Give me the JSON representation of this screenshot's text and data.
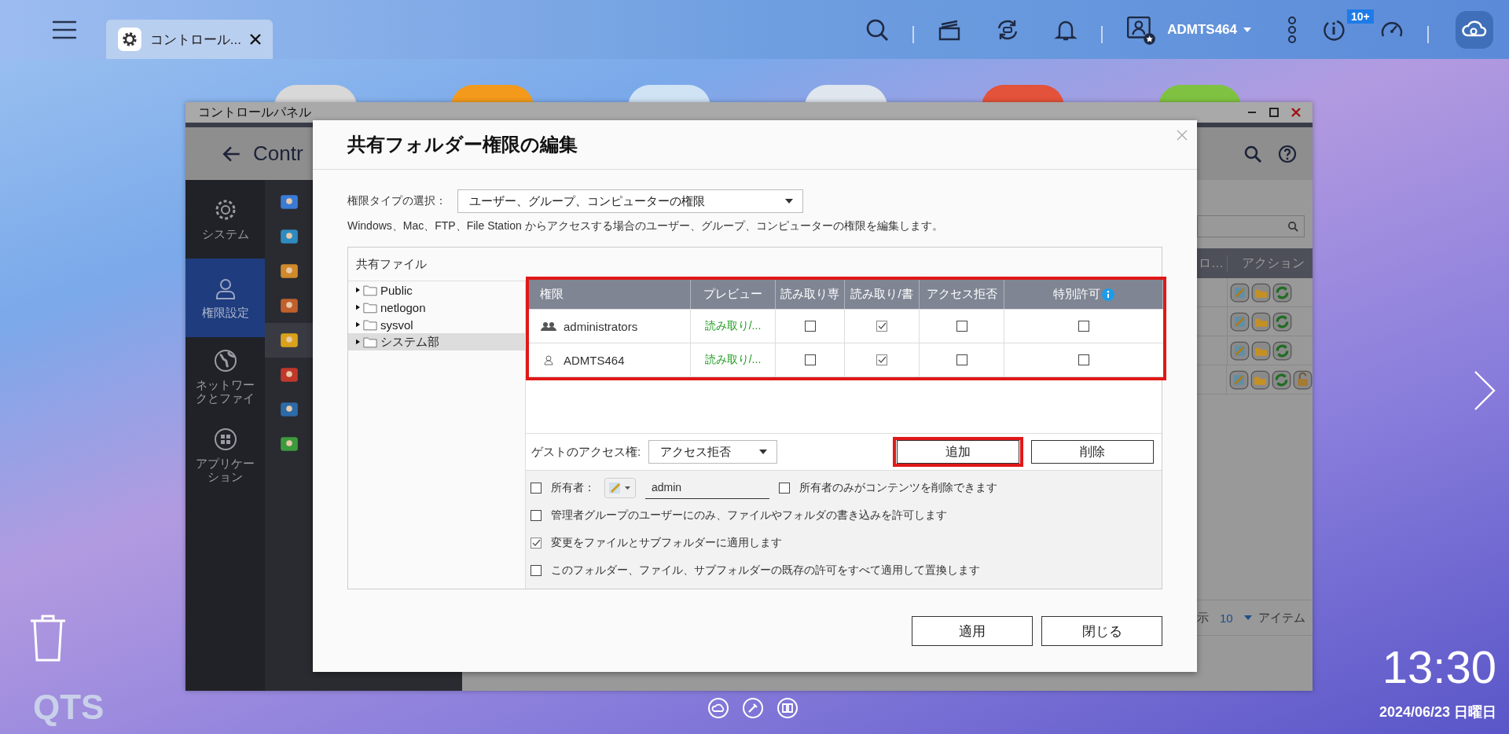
{
  "taskbar": {
    "tab": {
      "title": "コントロール..."
    },
    "user": "ADMTS464",
    "notification_badge": "10+"
  },
  "desktop": {
    "logo": "QTS",
    "clock": "13:30",
    "date": "2024/06/23 日曜日"
  },
  "control_panel": {
    "title": "コントロールパネル",
    "header": "Contr",
    "nav": [
      {
        "label": "システム",
        "selected": false
      },
      {
        "label": "権限設定",
        "selected": true
      },
      {
        "label": "ネットワークとファイ",
        "selected": false
      },
      {
        "label": "アプリケーション",
        "selected": false
      }
    ],
    "sub_items": [
      {
        "selected": false
      },
      {
        "selected": false
      },
      {
        "selected": false
      },
      {
        "selected": false
      },
      {
        "selected": true
      },
      {
        "selected": false
      },
      {
        "selected": false
      },
      {
        "selected": false
      }
    ],
    "table": {
      "columns": [
        "ロ…",
        "アクション"
      ],
      "rows": [
        {
          "locked": false
        },
        {
          "locked": false
        },
        {
          "locked": false
        },
        {
          "locked": true
        }
      ]
    },
    "footer": {
      "show": "示",
      "per_page": "10",
      "unit": "アイテム"
    }
  },
  "dialog": {
    "title": "共有フォルダー権限の編集",
    "type_label": "権限タイプの選択：",
    "type_value": "ユーザー、グループ、コンピューターの権限",
    "description": "Windows、Mac、FTP、File Station からアクセスする場合のユーザー、グループ、コンピューターの権限を編集します。",
    "tree_title": "共有ファイル",
    "folders": [
      {
        "name": "Public",
        "selected": false
      },
      {
        "name": "netlogon",
        "selected": false
      },
      {
        "name": "sysvol",
        "selected": false
      },
      {
        "name": "システム部",
        "selected": true
      }
    ],
    "columns": [
      "権限",
      "プレビュー",
      "読み取り専",
      "読み取り/書",
      "アクセス拒否",
      "特別許可"
    ],
    "rows": [
      {
        "kind": "group",
        "name": "administrators",
        "preview": "読み取り/...",
        "read_only": false,
        "read_write": true,
        "deny": false,
        "special": false
      },
      {
        "kind": "user",
        "name": "ADMTS464",
        "preview": "読み取り/...",
        "read_only": false,
        "read_write": true,
        "deny": false,
        "special": false
      }
    ],
    "guest_label": "ゲストのアクセス権:",
    "guest_value": "アクセス拒否",
    "add": "追加",
    "remove": "削除",
    "owner": {
      "checked": false,
      "label": "所有者：",
      "value": "admin"
    },
    "owner_only": {
      "checked": false,
      "label": "所有者のみがコンテンツを削除できます"
    },
    "options": [
      {
        "checked": false,
        "label": "管理者グループのユーザーにのみ、ファイルやフォルダの書き込みを許可します"
      },
      {
        "checked": true,
        "label": "変更をファイルとサブフォルダーに適用します"
      },
      {
        "checked": false,
        "label": "このフォルダー、ファイル、サブフォルダーの既存の許可をすべて適用して置換します"
      }
    ],
    "buttons": [
      "適用",
      "閉じる"
    ]
  }
}
